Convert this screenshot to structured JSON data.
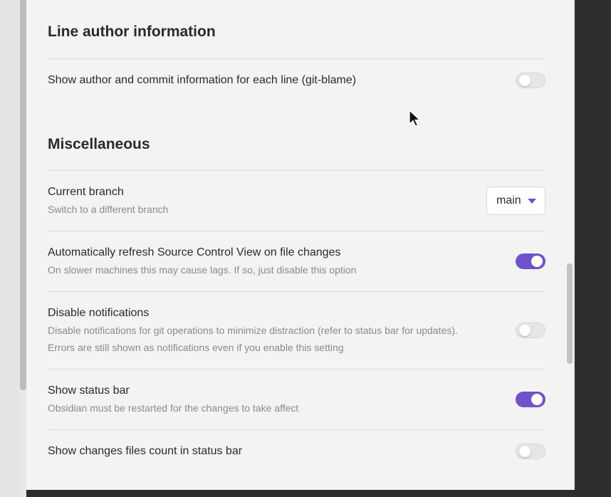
{
  "sections": {
    "line_author": {
      "heading": "Line author information",
      "git_blame": {
        "name": "Show author and commit information for each line (git-blame)",
        "enabled": false
      }
    },
    "misc": {
      "heading": "Miscellaneous",
      "current_branch": {
        "name": "Current branch",
        "desc": "Switch to a different branch",
        "value": "main"
      },
      "auto_refresh": {
        "name": "Automatically refresh Source Control View on file changes",
        "desc": "On slower machines this may cause lags. If so, just disable this option",
        "enabled": true
      },
      "disable_notifications": {
        "name": "Disable notifications",
        "desc_line1": "Disable notifications for git operations to minimize distraction (refer to status bar for updates).",
        "desc_line2": "Errors are still shown as notifications even if you enable this setting",
        "enabled": false
      },
      "status_bar": {
        "name": "Show status bar",
        "desc": "Obsidian must be restarted for the changes to take affect",
        "enabled": true
      },
      "changes_count": {
        "name": "Show changes files count in status bar",
        "enabled": false
      }
    }
  },
  "colors": {
    "accent": "#7152c8",
    "panel_bg": "#f2f3f2",
    "desc_text": "#8a8a8a"
  }
}
